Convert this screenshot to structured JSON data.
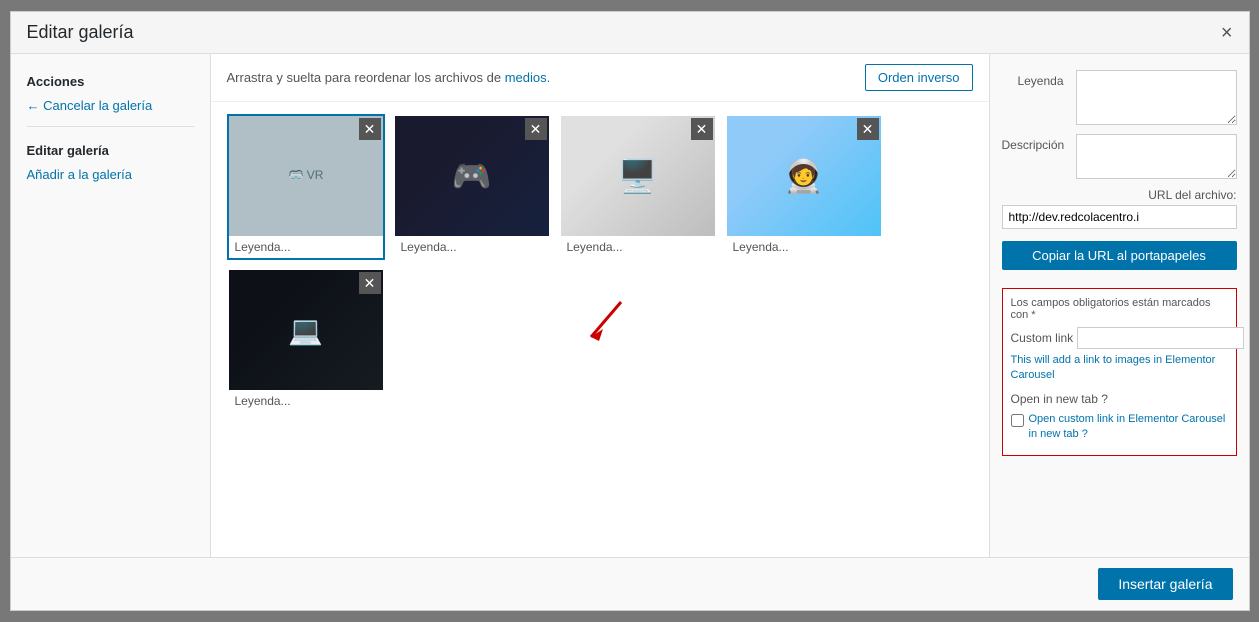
{
  "modal": {
    "title": "Editar galería",
    "close_label": "×"
  },
  "sidebar": {
    "acciones_label": "Acciones",
    "cancel_link": "← Cancelar la galería",
    "edit_gallery_label": "Editar galería",
    "add_link": "Añadir a la galería"
  },
  "toolbar": {
    "instruction": "Arrastra y suelta para reordenar los archivos de medios.",
    "inverse_button": "Orden inverso"
  },
  "gallery_items": [
    {
      "id": 1,
      "caption": "Leyenda...",
      "selected": true,
      "type": "vr",
      "emoji": "🥽"
    },
    {
      "id": 2,
      "caption": "Leyenda...",
      "selected": false,
      "type": "dark",
      "emoji": "🎮"
    },
    {
      "id": 3,
      "caption": "Leyenda...",
      "selected": false,
      "type": "desk",
      "emoji": "🖥️"
    },
    {
      "id": 4,
      "caption": "Leyenda...",
      "selected": false,
      "type": "astro",
      "emoji": "🧑‍🚀"
    },
    {
      "id": 5,
      "caption": "Leyenda...",
      "selected": false,
      "type": "code",
      "emoji": "💻"
    }
  ],
  "right_panel": {
    "leyenda_label": "Leyenda",
    "descripcion_label": "Descripción",
    "url_label": "URL del archivo:",
    "url_value": "http://dev.redcolacentro.i",
    "copy_button": "Copiar la URL al portapapeles",
    "required_note": "Los campos obligatorios están marcados con *",
    "custom_link_label": "Custom link",
    "custom_link_hint": "This will add a link to images in Elementor Carousel",
    "open_tab_label": "Open in new tab ?",
    "checkbox_hint": "Open custom link in Elementor Carousel in new tab ?"
  },
  "footer": {
    "insert_button": "Insertar galería"
  }
}
